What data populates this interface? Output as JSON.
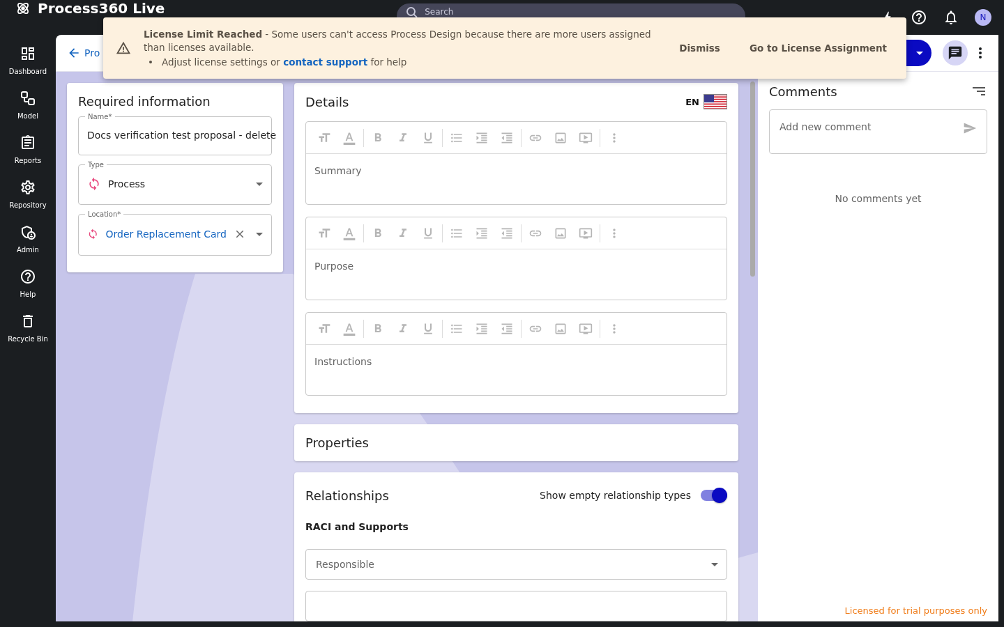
{
  "app": {
    "logo_text": "Process360 Live",
    "search_placeholder": "Search",
    "avatar": "N"
  },
  "nav": [
    {
      "label": "Dashboard"
    },
    {
      "label": "Model"
    },
    {
      "label": "Reports"
    },
    {
      "label": "Repository"
    },
    {
      "label": "Admin"
    },
    {
      "label": "Help"
    },
    {
      "label": "Recycle Bin"
    }
  ],
  "banner": {
    "message": "**License Limit Reached** - Some users can't access Process Design because there are more users assigned than licenses available.",
    "bullet": "•",
    "bullet_before": "Adjust license settings or",
    "link": "contact support",
    "bullet_after": "for help",
    "actions": [
      "Dismiss",
      "Go to License Assignment"
    ]
  },
  "header": {
    "back_label": "Pro"
  },
  "required": {
    "title": "Required information",
    "fields": [
      {
        "kind": "text",
        "label": "Name*",
        "value": "Docs verification test proposal - delete"
      },
      {
        "kind": "select",
        "label": "Type",
        "value": "Process"
      },
      {
        "kind": "location",
        "label": "Location*",
        "value": "Order Replacement Card"
      }
    ]
  },
  "details": {
    "title": "Details",
    "language": "EN",
    "editors": [
      {
        "placeholder": "Summary"
      },
      {
        "placeholder": "Purpose"
      },
      {
        "placeholder": "Instructions"
      }
    ]
  },
  "properties": {
    "title": "Properties"
  },
  "relationships": {
    "title": "Relationships",
    "toggle_label": "Show empty relationship types",
    "show_empty": true,
    "section": "RACI and Supports",
    "selects": [
      {
        "placeholder": "Responsible"
      },
      {
        "kind": "cut"
      }
    ]
  },
  "comments": {
    "title": "Comments",
    "placeholder": "Add new comment",
    "empty_text": "No comments yet"
  },
  "footer": {
    "license_note": "Licensed for trial purposes only"
  }
}
